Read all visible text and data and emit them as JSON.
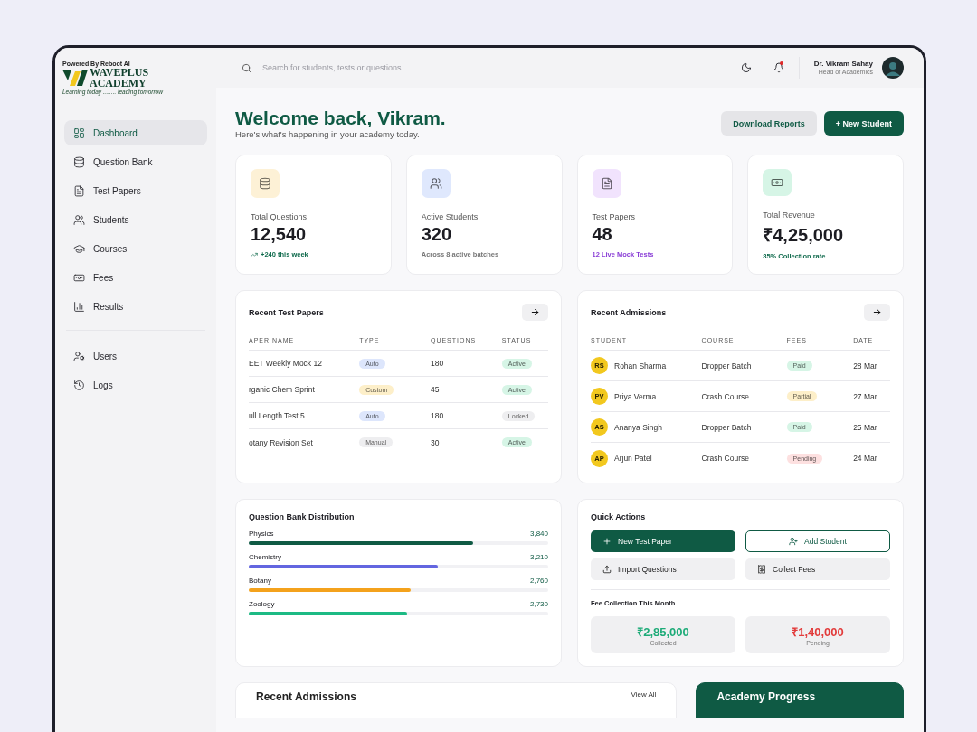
{
  "brand": {
    "powered_by": "Powered By Reboot AI",
    "line_1": "WAVEPLUS",
    "line_2": "ACADEMY",
    "tagline": "Learning today ........ leading tomorrow"
  },
  "sidebar": {
    "sections": [
      [
        {
          "label": "Dashboard",
          "selected": true
        },
        {
          "label": "Question Bank",
          "selected": false
        },
        {
          "label": "Test Papers",
          "selected": false
        },
        {
          "label": "Students",
          "selected": false
        },
        {
          "label": "Courses",
          "selected": false
        },
        {
          "label": "Fees",
          "selected": false
        },
        {
          "label": "Results",
          "selected": false
        }
      ],
      [
        {
          "label": "Users",
          "selected": false
        },
        {
          "label": "Logs",
          "selected": false
        }
      ]
    ]
  },
  "topbar": {
    "search": {
      "placeholder": "Search for students, tests or questions..."
    },
    "notification_unread": true,
    "user": {
      "name": "Dr. Vikram Sahay",
      "role": "Head of Academics"
    }
  },
  "header": {
    "title": "Welcome back, Vikram.",
    "subtitle": "Here's what's happening in your academy today.",
    "buttons": [
      {
        "label": "Download Reports",
        "kind": "secondary"
      },
      {
        "label": "+ New Student",
        "kind": "primary"
      }
    ]
  },
  "stats": [
    {
      "label": "Total Questions",
      "value": "12,540",
      "color": "#fdf1d6",
      "note": {
        "text": "+240 this week",
        "color": "#0f6a4c"
      },
      "trend": true
    },
    {
      "label": "Active Students",
      "value": "320",
      "color": "#dfe8fd",
      "note": {
        "text": "Across 8 active batches",
        "color": "#777777"
      },
      "trend": false
    },
    {
      "label": "Test Papers",
      "value": "48",
      "color": "#f1e3fd",
      "note": {
        "text": "12 Live Mock Tests",
        "color": "#8a3ed6"
      },
      "trend": false
    },
    {
      "label": "Total Revenue",
      "value": "₹4,25,000",
      "color": "#d6f5e6",
      "note": {
        "text": "85% Collection rate",
        "color": "#0f6a4c"
      },
      "trend": false
    }
  ],
  "recent_test_papers": {
    "title": "Recent Test Papers",
    "columns": [
      "APER NAME",
      "TYPE",
      "QUESTIONS",
      "STATUS"
    ],
    "rows": [
      {
        "name": "EET Weekly Mock 12",
        "type": {
          "label": "Auto",
          "color": "#dde6fc"
        },
        "questions": "180",
        "status": {
          "label": "Active",
          "color": "#d6f5e6"
        }
      },
      {
        "name": "rganic Chem Sprint",
        "type": {
          "label": "Custom",
          "color": "#fdefc9"
        },
        "questions": "45",
        "status": {
          "label": "Active",
          "color": "#d6f5e6"
        }
      },
      {
        "name": "ull Length Test 5",
        "type": {
          "label": "Auto",
          "color": "#dde6fc"
        },
        "questions": "180",
        "status": {
          "label": "Locked",
          "color": "#eeeef0"
        }
      },
      {
        "name": "otany Revision Set",
        "type": {
          "label": "Manual",
          "color": "#eeeef0"
        },
        "questions": "30",
        "status": {
          "label": "Active",
          "color": "#d6f5e6"
        }
      }
    ]
  },
  "recent_admissions": {
    "title": "Recent Admissions",
    "columns": [
      "STUDENT",
      "COURSE",
      "FEES",
      "DATE"
    ],
    "rows": [
      {
        "initials": "RS",
        "student": "Rohan Sharma",
        "course": "Dropper Batch",
        "fees": {
          "label": "Paid",
          "color": "#d6f5e6"
        },
        "date": "28 Mar"
      },
      {
        "initials": "PV",
        "student": "Priya Verma",
        "course": "Crash Course",
        "fees": {
          "label": "Partial",
          "color": "#fdefc9"
        },
        "date": "27 Mar"
      },
      {
        "initials": "AS",
        "student": "Ananya Singh",
        "course": "Dropper Batch",
        "fees": {
          "label": "Paid",
          "color": "#d6f5e6"
        },
        "date": "25 Mar"
      },
      {
        "initials": "AP",
        "student": "Arjun Patel",
        "course": "Crash Course",
        "fees": {
          "label": "Pending",
          "color": "#fde0e0"
        },
        "date": "24 Mar"
      }
    ]
  },
  "distribution": {
    "title": "Question Bank Distribution",
    "subjects": [
      {
        "name": "Physics",
        "count": "3,840",
        "level": 0.75,
        "color": "#0f5a44"
      },
      {
        "name": "Chemistry",
        "count": "3,210",
        "level": 0.63,
        "color": "#6366e0"
      },
      {
        "name": "Botany",
        "count": "2,760",
        "level": 0.54,
        "color": "#f4a21c"
      },
      {
        "name": "Zoology",
        "count": "2,730",
        "level": 0.53,
        "color": "#1dba84"
      }
    ]
  },
  "quick_actions": {
    "title": "Quick Actions",
    "actions": [
      {
        "label": "New Test Paper",
        "kind": "primary"
      },
      {
        "label": "Add Student",
        "kind": "outline"
      },
      {
        "label": "Import Questions",
        "kind": "secondary"
      },
      {
        "label": "Collect Fees",
        "kind": "secondary"
      }
    ],
    "fee_title": "Fee Collection This Month",
    "fees": [
      {
        "amount": "₹2,85,000",
        "label": "Collected",
        "color": "#1dab78"
      },
      {
        "amount": "₹1,40,000",
        "label": "Pending",
        "color": "#e23b3b"
      }
    ]
  },
  "bottom": {
    "left_title": "Recent Admissions",
    "left_link": "View All",
    "right_title": "Academy Progress"
  }
}
